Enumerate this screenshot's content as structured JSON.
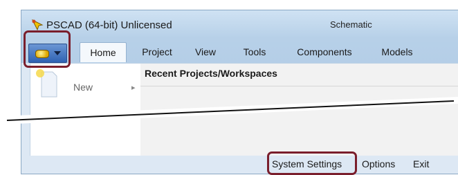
{
  "window": {
    "app_title": "PSCAD (64-bit) Unlicensed",
    "document_title": "Schematic"
  },
  "tabs": [
    {
      "label": "Home",
      "active": true
    },
    {
      "label": "Project"
    },
    {
      "label": "View"
    },
    {
      "label": "Tools"
    },
    {
      "label": "Components"
    },
    {
      "label": "Models"
    }
  ],
  "app_menu": {
    "new_label": "New",
    "recent_header": "Recent Projects/Workspaces",
    "footer": {
      "system_settings": "System Settings",
      "options": "Options",
      "exit": "Exit"
    }
  },
  "colors": {
    "highlight": "#7a1e2c",
    "ribbon_blue": "#2f62b3"
  }
}
